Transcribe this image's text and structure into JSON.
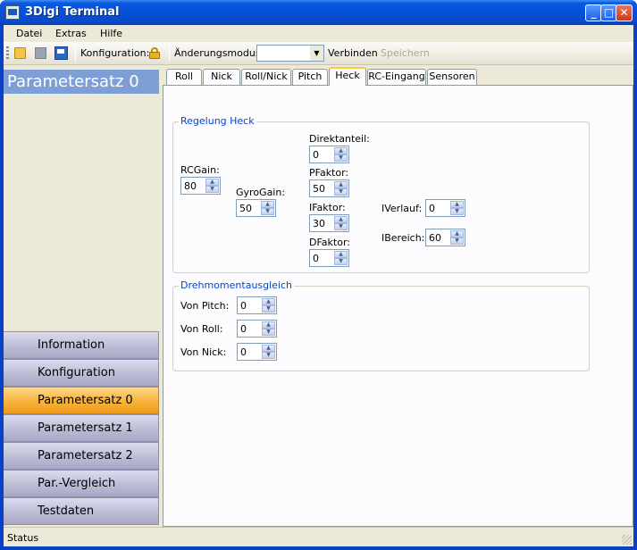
{
  "window": {
    "title": "3Digi Terminal"
  },
  "menu": {
    "items": [
      "Datei",
      "Extras",
      "Hilfe"
    ]
  },
  "toolbar": {
    "config_label": "Konfiguration:",
    "mode_label": "Änderungsmodus:",
    "mode_value": "",
    "connect_label": "Verbinden",
    "save_label": "Speichern",
    "save_color": "#aca899"
  },
  "sidebar": {
    "header": "Parametersatz 0",
    "items": [
      {
        "label": "Information"
      },
      {
        "label": "Konfiguration"
      },
      {
        "label": "Parametersatz 0",
        "active": true
      },
      {
        "label": "Parametersatz 1"
      },
      {
        "label": "Parametersatz 2"
      },
      {
        "label": "Par.-Vergleich"
      },
      {
        "label": "Testdaten"
      }
    ]
  },
  "tabs": [
    "Roll",
    "Nick",
    "Roll/Nick",
    "Pitch",
    "Heck",
    "RC-Eingang",
    "Sensoren"
  ],
  "active_tab": "Heck",
  "regelung": {
    "title": "Regelung Heck",
    "rcgain": {
      "label": "RCGain:",
      "value": "80"
    },
    "gyrogain": {
      "label": "GyroGain:",
      "value": "50"
    },
    "direktanteil": {
      "label": "Direktanteil:",
      "value": "0"
    },
    "pfaktor": {
      "label": "PFaktor:",
      "value": "50"
    },
    "ifaktor": {
      "label": "IFaktor:",
      "value": "30"
    },
    "dfaktor": {
      "label": "DFaktor:",
      "value": "0"
    },
    "iverlauf": {
      "label": "IVerlauf:",
      "value": "0"
    },
    "ibereich": {
      "label": "IBereich:",
      "value": "60"
    }
  },
  "drehmoment": {
    "title": "Drehmomentausgleich",
    "von_pitch": {
      "label": "Von Pitch:",
      "value": "0"
    },
    "von_roll": {
      "label": "Von Roll:",
      "value": "0"
    },
    "von_nick": {
      "label": "Von Nick:",
      "value": "0"
    }
  },
  "status": {
    "text": "Status"
  },
  "colors": {
    "titlebar": "#0a5ae0",
    "group_title": "#0046d5",
    "active_nav": "#f6b33a",
    "sidebar_header": "#7e9fd6"
  }
}
